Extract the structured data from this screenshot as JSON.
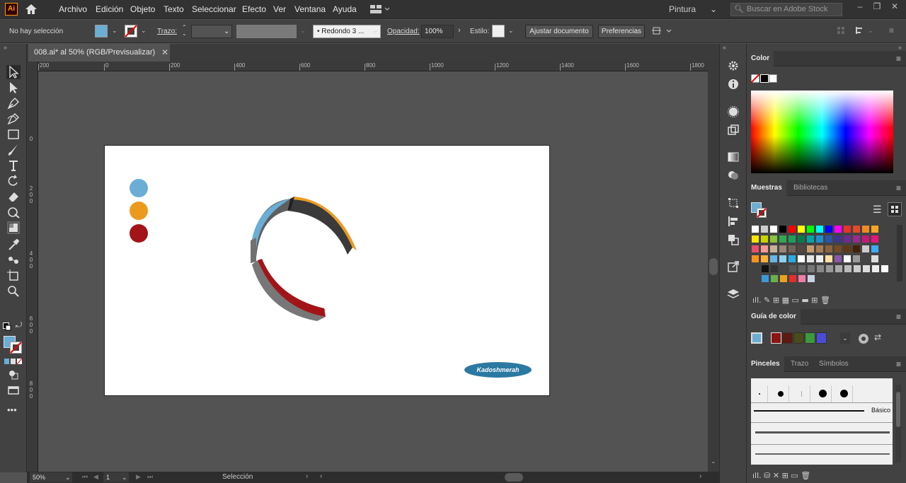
{
  "app": {
    "logo": "Ai",
    "home_icon": "home-icon"
  },
  "menu": [
    "Archivo",
    "Edición",
    "Objeto",
    "Texto",
    "Seleccionar",
    "Efecto",
    "Ver",
    "Ventana",
    "Ayuda"
  ],
  "workspace": "Pintura",
  "stock_search_placeholder": "Buscar en Adobe Stock",
  "control": {
    "selection": "No hay selección",
    "stroke_label": "Trazo:",
    "brush_label": "Redondo 3 ...",
    "opacity_label": "Opacidad:",
    "opacity_value": "100%",
    "style_label": "Estilo:",
    "doc_setup": "Ajustar documento",
    "preferences": "Preferencias"
  },
  "document": {
    "tab": "008.ai* al 50% (RGB/Previsualizar)"
  },
  "ruler": {
    "h": [
      "200",
      "0",
      "200",
      "400",
      "600",
      "800",
      "1000",
      "1200",
      "1400",
      "1600",
      "1800"
    ],
    "v": [
      "0",
      "2 0 0",
      "4 0 0",
      "6 0 0",
      "8 0 0"
    ]
  },
  "artboard": {
    "dot_colors": [
      "#6aaed6",
      "#ec9a1e",
      "#a31418"
    ],
    "logo_text": "Kadoshmerah"
  },
  "status": {
    "zoom": "50%",
    "page": "1",
    "tool": "Selección"
  },
  "panels": {
    "color": {
      "title": "Color"
    },
    "swatches": {
      "tabs": [
        "Muestras",
        "Bibliotecas"
      ]
    },
    "color_guide": {
      "title": "Guía de color",
      "colors": [
        "#8c1414",
        "#5a1a0f",
        "#4a4a1a",
        "#3b9a3b",
        "#4b4bd8"
      ]
    },
    "brushes": {
      "tabs": [
        "Pinceles",
        "Trazo",
        "Símbolos"
      ],
      "brush_name": "Básico"
    }
  },
  "colors": {
    "accent": "#6aaed6",
    "orange": "#ec9a1e",
    "red": "#a31418"
  }
}
